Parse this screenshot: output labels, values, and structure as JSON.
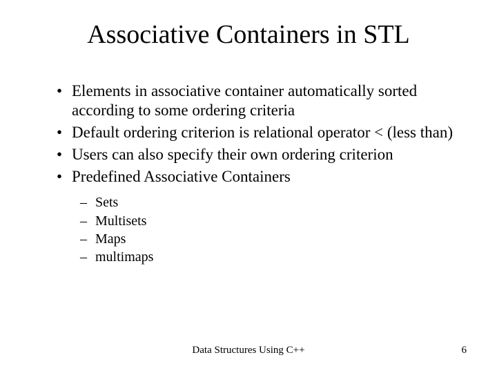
{
  "title": "Associative Containers in STL",
  "bullets": [
    "Elements in associative container automatically sorted according to some ordering criteria",
    "Default ordering criterion is relational operator < (less than)",
    "Users can also specify their own ordering criterion",
    "Predefined Associative Containers"
  ],
  "subbullets": [
    "Sets",
    "Multisets",
    "Maps",
    "multimaps"
  ],
  "footer": {
    "center": "Data Structures Using C++",
    "page": "6"
  }
}
